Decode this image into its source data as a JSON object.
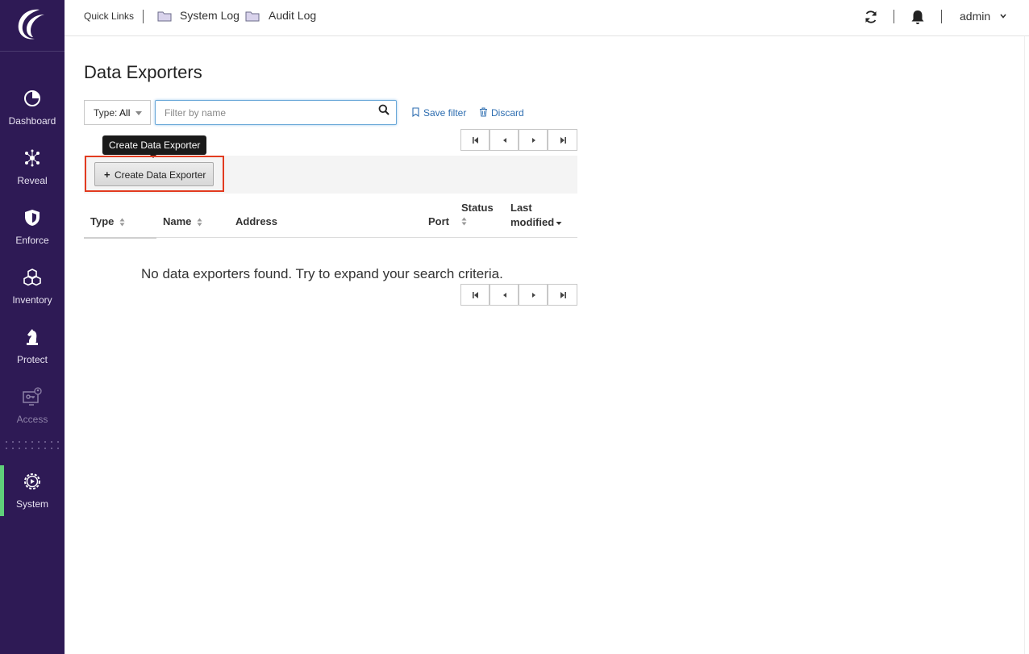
{
  "sidebar": {
    "items": [
      {
        "label": "Dashboard",
        "icon": "dashboard-icon"
      },
      {
        "label": "Reveal",
        "icon": "reveal-icon"
      },
      {
        "label": "Enforce",
        "icon": "shield-icon"
      },
      {
        "label": "Inventory",
        "icon": "inventory-icon"
      },
      {
        "label": "Protect",
        "icon": "chess-knight-icon"
      },
      {
        "label": "Access",
        "icon": "access-icon"
      },
      {
        "label": "System",
        "icon": "gear-icon"
      }
    ],
    "active": "System",
    "accent_color": "#5fd07a",
    "bg_color": "#2e1a55"
  },
  "topbar": {
    "quick_links_label": "Quick Links",
    "links": [
      "System Log",
      "Audit Log"
    ],
    "user": "admin"
  },
  "page": {
    "title": "Data Exporters",
    "filter": {
      "type_label": "Type:",
      "type_value": "All",
      "search_placeholder": "Filter by name",
      "search_value": "",
      "save_filter": "Save filter",
      "discard": "Discard"
    },
    "tooltip": "Create Data Exporter",
    "create_button": "Create Data Exporter",
    "table": {
      "columns": [
        {
          "line1": "Type",
          "line2": ""
        },
        {
          "line1": "Name",
          "line2": ""
        },
        {
          "line1": "Address",
          "line2": ""
        },
        {
          "line1": "Port",
          "line2": ""
        },
        {
          "line1": "Status",
          "line2": ""
        },
        {
          "line1": "Last",
          "line2": "modified"
        }
      ],
      "empty_message": "No data exporters found. Try to expand your search criteria."
    }
  }
}
